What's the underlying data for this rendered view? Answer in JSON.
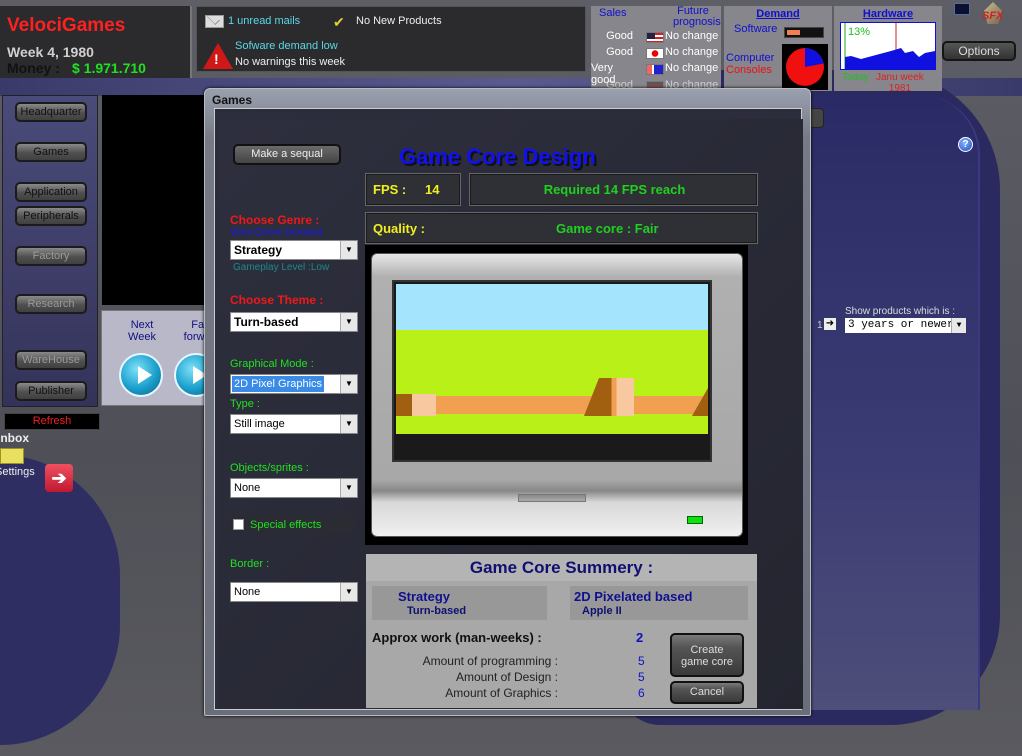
{
  "header": {
    "company": "VelociGames",
    "week": "Week 4, 1980",
    "money_label": "Money :",
    "money_value": "$ 1.971.710"
  },
  "notifications": {
    "mail_icon": "envelope-icon",
    "mail_text": "1 unread mails",
    "products_icon": "checkmark-icon",
    "products_text": "No New Products",
    "warning_icon": "warning-triangle-icon",
    "warning_line1": "Sofware demand low",
    "warning_line2": "No warnings this week"
  },
  "sales": {
    "sales_header": "Sales",
    "prognosis_header": "Future prognosis",
    "rows": [
      {
        "sales": "Good",
        "flag": "usa-flag-icon",
        "prognosis": "No change"
      },
      {
        "sales": "Good",
        "flag": "japan-flag-icon",
        "prognosis": "No change"
      },
      {
        "sales": "Very good",
        "flag": "europe-flag-icon",
        "prognosis": "No change"
      },
      {
        "sales": "Good",
        "flag": "other-flag-icon",
        "prognosis": "No change"
      }
    ]
  },
  "demand": {
    "title": "Demand",
    "software_label": "Software",
    "software_level": 0.35,
    "computer_label": "Computer",
    "consoles_label": "Consoles",
    "computer_share": 0.22,
    "consoles_share": 0.78
  },
  "hardware": {
    "title": "Hardware",
    "percent": "13%",
    "today_label": "Today",
    "week_label": "Janu week",
    "week_year": "1981"
  },
  "top_right": {
    "sfx_label": "SFX",
    "options_button": "Options"
  },
  "nav": {
    "items": [
      {
        "label": "Headquarter",
        "enabled": true
      },
      {
        "label": "Games",
        "enabled": true
      },
      {
        "label": "Application",
        "enabled": true
      },
      {
        "label": "Peripherals",
        "enabled": true
      },
      {
        "label": "Factory",
        "enabled": false
      },
      {
        "label": "Research",
        "enabled": false
      },
      {
        "label": "WareHouse",
        "enabled": false
      },
      {
        "label": "Publisher",
        "enabled": true
      }
    ],
    "next_week_line1": "Next",
    "next_week_line2": "Week",
    "fast_forward_line1": "Fast",
    "fast_forward_line2": "forward",
    "refresh": "Refresh",
    "inbox": "Inbox",
    "settings": "Settings"
  },
  "right_panel": {
    "show_label": "Show products which is :",
    "page_number": "1",
    "filter_value": "3 years or newer"
  },
  "dialog": {
    "title": "Games",
    "make_sequel": "Make a sequal",
    "heading": "Game Core Design",
    "fps_label": "FPS :",
    "fps_value": "14",
    "required_text": "Required 14 FPS reach",
    "quality_label": "Quality :",
    "quality_value": "Game core : Fair",
    "genre_label": "Choose Genre :",
    "genre_link": "View Genre Demand",
    "genre_value": "Strategy",
    "gameplay_level": "Gameplay Level :Low",
    "theme_label": "Choose Theme :",
    "theme_value": "Turn-based",
    "graphical_mode_label": "Graphical Mode :",
    "graphical_mode_value": "2D Pixel Graphics",
    "type_label": "Type :",
    "type_value": "Still image",
    "objects_label": "Objects/sprites :",
    "objects_value": "None",
    "special_effects_label": "Special effects",
    "special_effects_checked": false,
    "border_label": "Border :",
    "border_value": "None"
  },
  "summary": {
    "title": "Game Core Summery :",
    "genre": "Strategy",
    "theme": "Turn-based",
    "graphics": "2D Pixelated based",
    "platform": "Apple II",
    "approx_label": "Approx work (man-weeks) :",
    "approx_value": "2",
    "programming_label": "Amount of programming :",
    "programming_value": "5",
    "design_label": "Amount of Design :",
    "design_value": "5",
    "graphics_label": "Amount of Graphics :",
    "graphics_value": "6",
    "create_line1": "Create",
    "create_line2": "game core",
    "cancel": "Cancel"
  },
  "colors": {
    "brand_red": "#ff2020",
    "money_green": "#20e020",
    "accent_blue": "#1010f0",
    "fps_yellow": "#f0f020"
  }
}
